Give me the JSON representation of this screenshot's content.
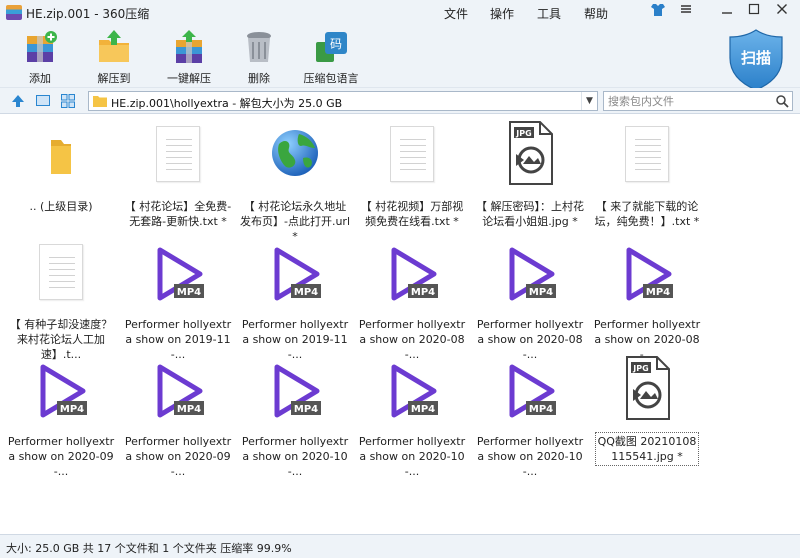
{
  "window": {
    "title": "HE.zip.001 - 360压缩"
  },
  "menu": [
    "文件",
    "操作",
    "工具",
    "帮助"
  ],
  "toolbar": {
    "buttons": [
      {
        "label": "添加",
        "icon": "add-archive-icon"
      },
      {
        "label": "解压到",
        "icon": "extract-to-icon"
      },
      {
        "label": "一键解压",
        "icon": "one-click-extract-icon"
      },
      {
        "label": "删除",
        "icon": "trash-icon"
      },
      {
        "label": "压缩包语言",
        "icon": "archive-language-icon"
      }
    ],
    "scan_label": "扫描"
  },
  "address": {
    "path": "HE.zip.001\\hollyextra - 解包大小为 25.0 GB"
  },
  "search": {
    "placeholder": "搜索包内文件"
  },
  "files": [
    {
      "name": ".. (上级目录)",
      "type": "folder"
    },
    {
      "name": "【 村花论坛】全免费-无套路-更新快.txt *",
      "type": "txt"
    },
    {
      "name": "【 村花论坛永久地址发布页】-点此打开.url *",
      "type": "url"
    },
    {
      "name": "【 村花视频】万部视频免费在线看.txt *",
      "type": "txt"
    },
    {
      "name": "【 解压密码】：上村花论坛看小姐姐.jpg *",
      "type": "jpg"
    },
    {
      "name": "【 来了就能下载的论坛，纯免费！】.txt *",
      "type": "txt"
    },
    {
      "name": "【 有种子却没速度？来村花论坛人工加速】.t...",
      "type": "txt"
    },
    {
      "name": "Performer hollyextra show on 2019-11-...",
      "type": "mp4"
    },
    {
      "name": "Performer hollyextra show on 2019-11-...",
      "type": "mp4"
    },
    {
      "name": "Performer hollyextra show on 2020-08-...",
      "type": "mp4"
    },
    {
      "name": "Performer hollyextra show on 2020-08-...",
      "type": "mp4"
    },
    {
      "name": "Performer hollyextra show on 2020-08-...",
      "type": "mp4"
    },
    {
      "name": "Performer hollyextra show on 2020-09-...",
      "type": "mp4"
    },
    {
      "name": "Performer hollyextra show on 2020-09-...",
      "type": "mp4"
    },
    {
      "name": "Performer hollyextra show on 2020-10-...",
      "type": "mp4"
    },
    {
      "name": "Performer hollyextra show on 2020-10-...",
      "type": "mp4"
    },
    {
      "name": "Performer hollyextra show on 2020-10-...",
      "type": "mp4"
    },
    {
      "name": "QQ截图 20210108115541.jpg *",
      "type": "jpg",
      "selected": true
    }
  ],
  "icon_text": {
    "mp4": "MP4",
    "jpg": "JPG"
  },
  "status": {
    "text": "大小: 25.0 GB 共 17 个文件和 1 个文件夹 压缩率 99.9%"
  },
  "colors": {
    "accent": "#2a7fc9",
    "mp4_purple": "#6c3bd1",
    "folder_yellow": "#f5c445"
  }
}
